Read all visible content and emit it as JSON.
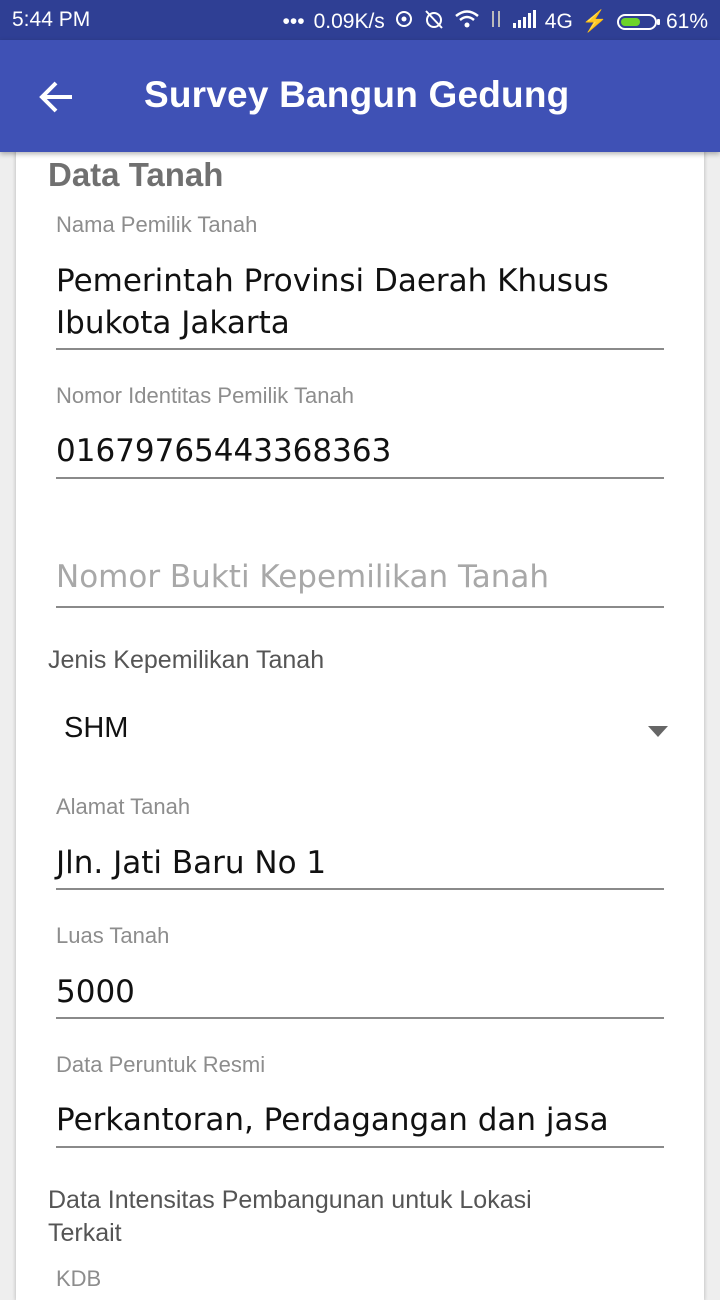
{
  "status_bar": {
    "time": "5:44 PM",
    "network_speed": "0.09K/s",
    "network_type": "4G",
    "battery": "61%",
    "battery_level": 0.61
  },
  "app_bar": {
    "title": "Survey Bangun Gedung",
    "back_icon": "arrow-back-icon"
  },
  "form": {
    "section_title": "Data Tanah",
    "owner_name": {
      "label": "Nama Pemilik Tanah",
      "value_line1": "Pemerintah Provinsi Daerah Khusus",
      "value_line2": "Ibukota Jakarta"
    },
    "owner_id": {
      "label": "Nomor Identitas Pemilik Tanah",
      "value": "01679765443368363"
    },
    "ownership_proof": {
      "placeholder": "Nomor Bukti Kepemilikan Tanah"
    },
    "ownership_type": {
      "label": "Jenis Kepemilikan Tanah",
      "selected": "SHM"
    },
    "land_address": {
      "label": "Alamat Tanah",
      "value": "Jln. Jati Baru No 1"
    },
    "land_area": {
      "label": "Luas Tanah",
      "value": "5000"
    },
    "official_use": {
      "label": "Data Peruntuk Resmi",
      "value": "Perkantoran, Perdagangan dan jasa"
    },
    "intensity": {
      "label_line1": "Data Intensitas Pembangunan untuk Lokasi",
      "label_line2": "Terkait"
    },
    "kdb": {
      "label": "KDB"
    }
  },
  "colors": {
    "status_bar": "#2f3f94",
    "app_bar": "#3f51b5",
    "background": "#eeeeee",
    "battery_fill": "#6dd42a"
  }
}
